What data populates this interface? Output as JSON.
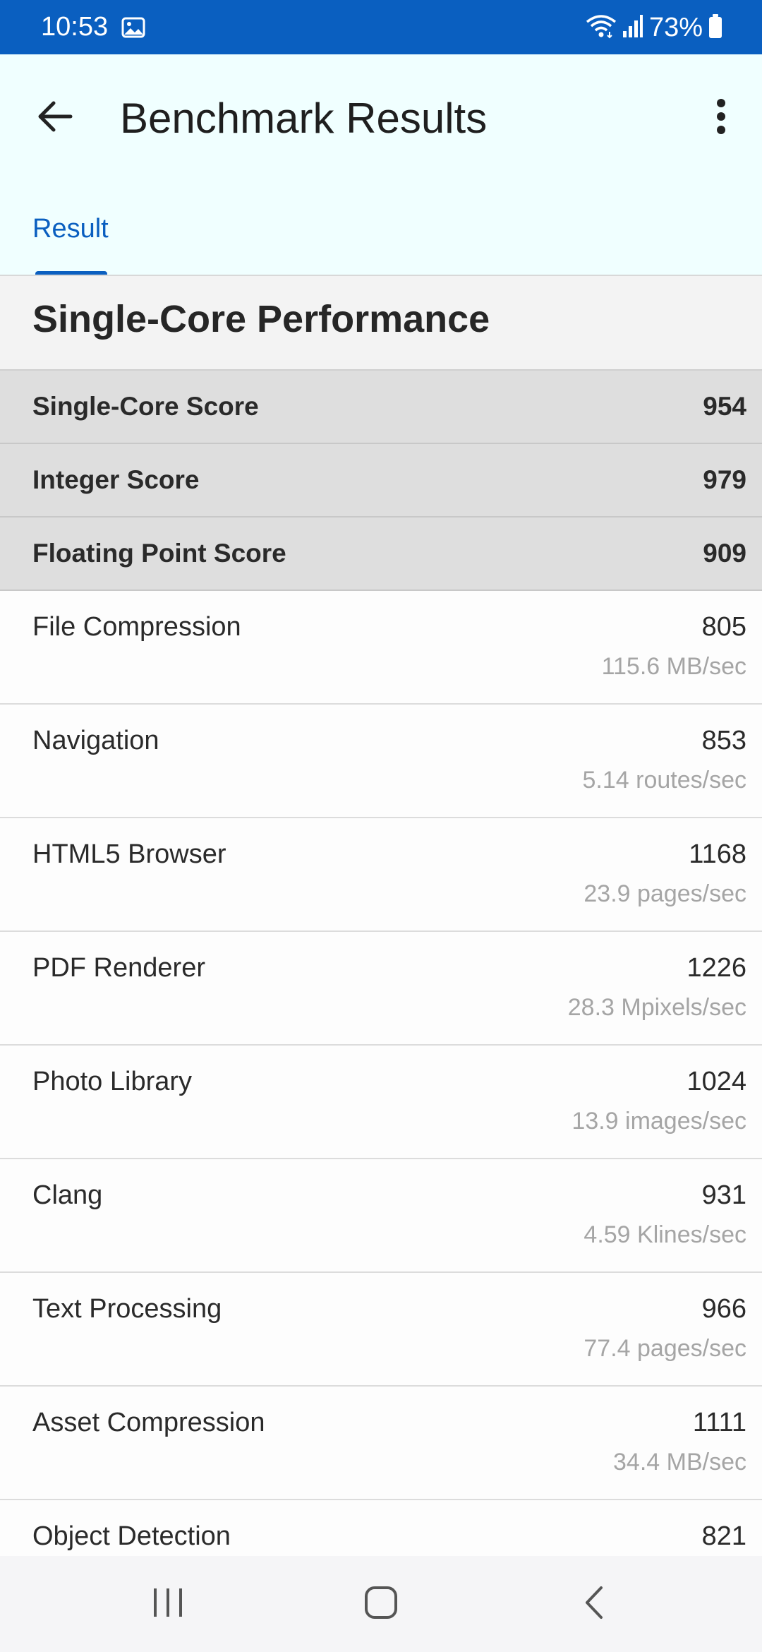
{
  "status_bar": {
    "time": "10:53",
    "battery": "73%",
    "bg_color": "#0a5fc0",
    "icons": [
      "image-icon",
      "wifi-icon",
      "signal-icon",
      "battery-icon"
    ]
  },
  "app_bar": {
    "title": "Benchmark Results",
    "back_icon": "arrow-back-icon",
    "menu_icon": "more-vert-icon",
    "bg_color": "#f0ffff"
  },
  "tabs": [
    {
      "label": "Result",
      "selected": true
    }
  ],
  "section": {
    "title": "Single-Core Performance"
  },
  "scores": [
    {
      "label": "Single-Core Score",
      "value": "954"
    },
    {
      "label": "Integer Score",
      "value": "979"
    },
    {
      "label": "Floating Point Score",
      "value": "909"
    }
  ],
  "benchmarks": [
    {
      "name": "File Compression",
      "score": "805",
      "rate": "115.6 MB/sec"
    },
    {
      "name": "Navigation",
      "score": "853",
      "rate": "5.14 routes/sec"
    },
    {
      "name": "HTML5 Browser",
      "score": "1168",
      "rate": "23.9 pages/sec"
    },
    {
      "name": "PDF Renderer",
      "score": "1226",
      "rate": "28.3 Mpixels/sec"
    },
    {
      "name": "Photo Library",
      "score": "1024",
      "rate": "13.9 images/sec"
    },
    {
      "name": "Clang",
      "score": "931",
      "rate": "4.59 Klines/sec"
    },
    {
      "name": "Text Processing",
      "score": "966",
      "rate": "77.4 pages/sec"
    },
    {
      "name": "Asset Compression",
      "score": "1111",
      "rate": "34.4 MB/sec"
    },
    {
      "name": "Object Detection",
      "score": "821",
      "rate": ""
    }
  ],
  "nav_bar": {
    "icons": [
      "recents-icon",
      "home-icon",
      "back-nav-icon"
    ]
  },
  "colors": {
    "accent": "#0a5fc0",
    "muted_text": "#a5a5a5",
    "score_row_bg": "#dedede"
  }
}
